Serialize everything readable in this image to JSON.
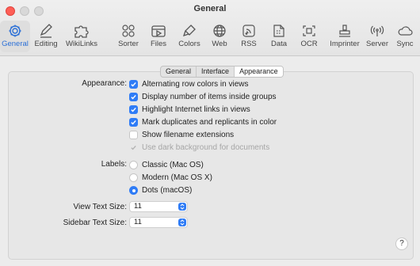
{
  "window": {
    "title": "General"
  },
  "toolbar": {
    "items": [
      {
        "label": "General",
        "icon": "gear-icon"
      },
      {
        "label": "Editing",
        "icon": "pencil-icon"
      },
      {
        "label": "WikiLinks",
        "icon": "puzzle-icon"
      },
      {
        "label": "Sorter",
        "icon": "circles-icon"
      },
      {
        "label": "Files",
        "icon": "files-icon"
      },
      {
        "label": "Colors",
        "icon": "paintbrush-icon"
      },
      {
        "label": "Web",
        "icon": "globe-icon"
      },
      {
        "label": "RSS",
        "icon": "rss-icon"
      },
      {
        "label": "Data",
        "icon": "data-icon"
      },
      {
        "label": "OCR",
        "icon": "ocr-icon"
      },
      {
        "label": "Imprinter",
        "icon": "stamp-icon"
      },
      {
        "label": "Server",
        "icon": "antenna-icon"
      },
      {
        "label": "Sync",
        "icon": "cloud-icon"
      }
    ],
    "selected": "General"
  },
  "tabs": {
    "items": [
      "General",
      "Interface",
      "Appearance"
    ],
    "active": "Appearance"
  },
  "appearance": {
    "label": "Appearance:",
    "options": [
      {
        "label": "Alternating row colors in views",
        "checked": true,
        "enabled": true
      },
      {
        "label": "Display number of items inside groups",
        "checked": true,
        "enabled": true
      },
      {
        "label": "Highlight Internet links in views",
        "checked": true,
        "enabled": true
      },
      {
        "label": "Mark duplicates and replicants in color",
        "checked": true,
        "enabled": true
      },
      {
        "label": "Show filename extensions",
        "checked": false,
        "enabled": true
      },
      {
        "label": "Use dark background for documents",
        "checked": true,
        "enabled": false
      }
    ]
  },
  "labels": {
    "label": "Labels:",
    "options": [
      {
        "label": "Classic (Mac OS)",
        "selected": false
      },
      {
        "label": "Modern (Mac OS X)",
        "selected": false
      },
      {
        "label": "Dots (macOS)",
        "selected": true
      }
    ]
  },
  "view_text_size": {
    "label": "View Text Size:",
    "value": "11"
  },
  "sidebar_text_size": {
    "label": "Sidebar Text Size:",
    "value": "11"
  },
  "help": {
    "label": "?"
  },
  "colors": {
    "accent": "#2f7cf6",
    "close": "#fe5f57"
  }
}
